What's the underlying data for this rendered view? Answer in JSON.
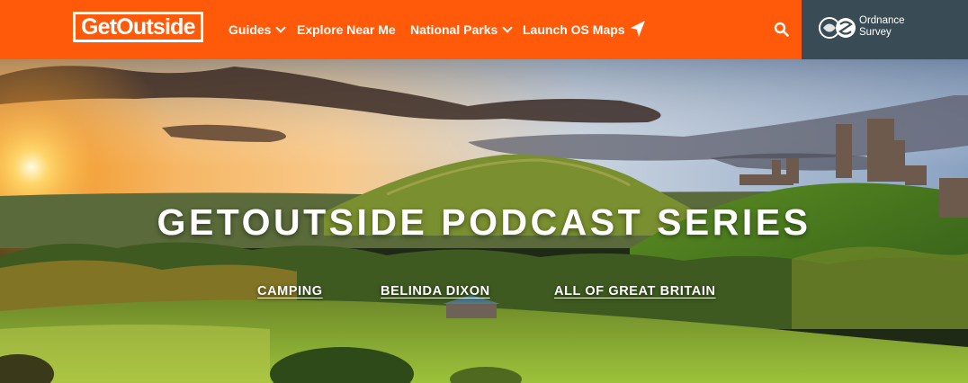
{
  "header": {
    "logo_text": "GetOutside",
    "nav": [
      {
        "label": "Guides",
        "has_dropdown": true
      },
      {
        "label": "Explore Near Me",
        "has_dropdown": false
      },
      {
        "label": "National Parks",
        "has_dropdown": true
      },
      {
        "label": "Launch OS Maps",
        "has_dropdown": false,
        "icon": "navigation-arrow-icon"
      }
    ],
    "search_icon": "search-icon",
    "partner": {
      "line1": "Ordnance",
      "line2": "Survey",
      "icon": "ordnance-survey-logo-icon"
    }
  },
  "colors": {
    "header_bg": "#ff5a0a",
    "partner_bg": "#394b55",
    "text": "#ffffff"
  },
  "hero": {
    "title": "GETOUTSIDE PODCAST SERIES",
    "tags": [
      "CAMPING",
      "BELINDA DIXON",
      "ALL OF GREAT BRITAIN"
    ]
  }
}
